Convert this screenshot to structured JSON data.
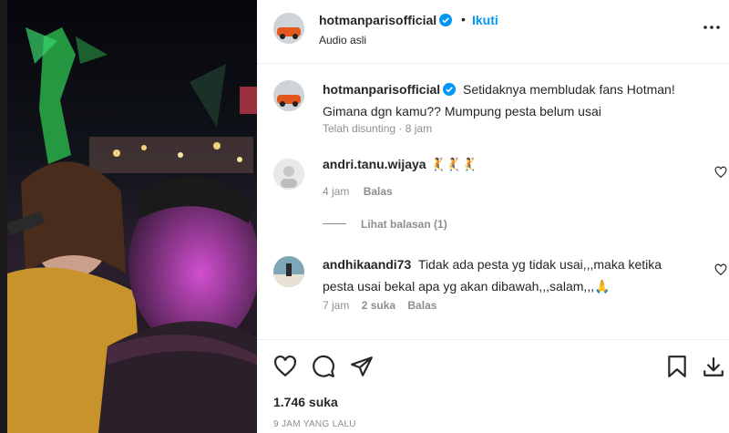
{
  "post": {
    "username": "hotmanparisofficial",
    "follow_label": "Ikuti",
    "separator": "•",
    "audio_label": "Audio asli",
    "caption": "Setidaknya membludak fans Hotman! Gimana dgn kamu?? Mumpung pesta belum usai",
    "caption_meta": "Telah disunting · 8 jam"
  },
  "comments": [
    {
      "username": "andri.tanu.wijaya",
      "text": "🤾🤾🤾",
      "time": "4 jam",
      "reply_label": "Balas",
      "view_replies": "Lihat balasan (1)"
    },
    {
      "username": "andhikaandi73",
      "text": "Tidak ada pesta yg tidak usai,,,maka ketika pesta usai bekal apa yg akan dibawah,,,salam,,,🙏",
      "time": "7 jam",
      "likes": "2 suka",
      "reply_label": "Balas"
    }
  ],
  "footer": {
    "likes": "1.746 suka",
    "time_ago": "9 JAM YANG LALU"
  },
  "icons": {
    "verified": "verified-badge-icon",
    "more": "more-options-icon",
    "heart": "heart-icon",
    "comment": "comment-icon",
    "share": "share-icon",
    "save": "bookmark-icon",
    "download": "download-icon"
  },
  "colors": {
    "accent": "#0095f6",
    "text": "#262626",
    "muted": "#8e8e8e"
  }
}
